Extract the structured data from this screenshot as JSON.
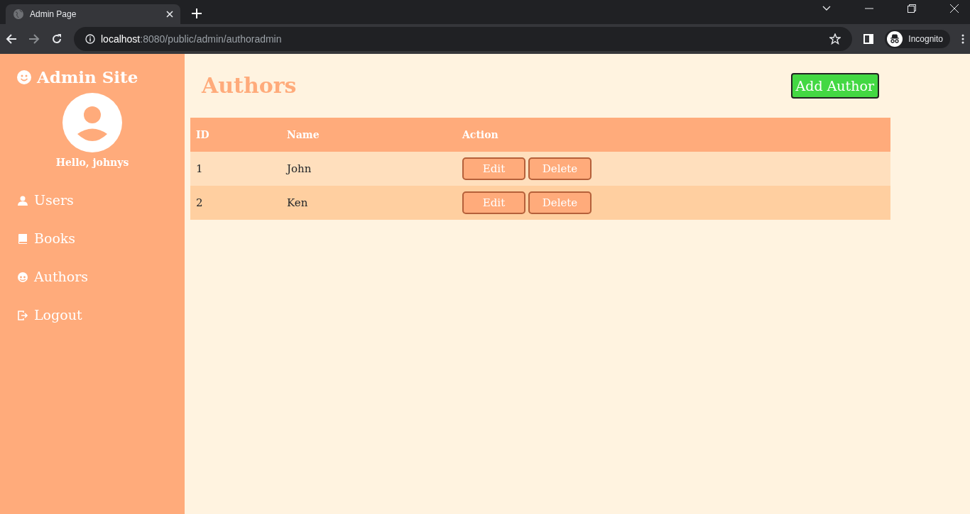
{
  "browser": {
    "tab_title": "Admin Page",
    "url_host": "localhost",
    "url_path": ":8080/public/admin/authoradmin",
    "profile_label": "Incognito"
  },
  "sidebar": {
    "title": "Admin Site",
    "greeting": "Hello, johnys",
    "items": [
      {
        "kind": "person",
        "label": "Users"
      },
      {
        "kind": "book",
        "label": "Books"
      },
      {
        "kind": "face",
        "label": "Authors"
      },
      {
        "kind": "exit",
        "label": "Logout"
      }
    ]
  },
  "main": {
    "heading": "Authors",
    "add_button": "Add Author",
    "table": {
      "columns": [
        "ID",
        "Name",
        "Action"
      ],
      "rows": [
        {
          "id": "1",
          "name": "John",
          "actions": [
            "Edit",
            "Delete"
          ]
        },
        {
          "id": "2",
          "name": "Ken",
          "actions": [
            "Edit",
            "Delete"
          ]
        }
      ]
    }
  }
}
